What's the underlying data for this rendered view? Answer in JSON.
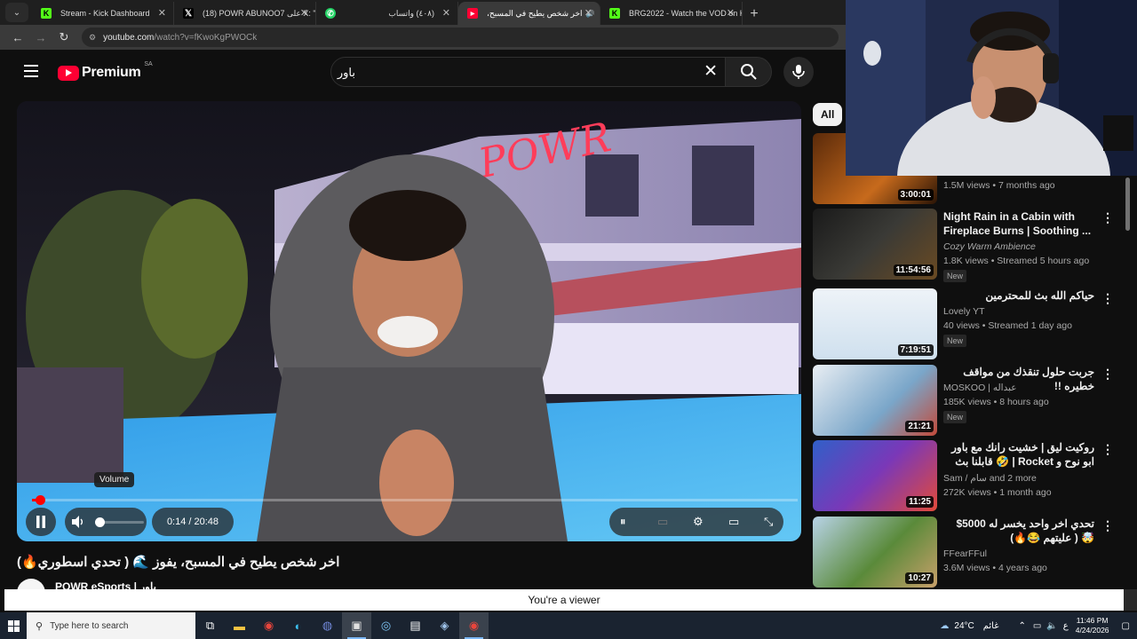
{
  "browser": {
    "tabs": [
      {
        "title": "Stream - Kick Dashboard",
        "favicon": "kick-icon",
        "color": "#53fc18",
        "active": false
      },
      {
        "title": "(18) POWR ABUNOO7 على X: \"",
        "favicon": "x-icon",
        "color": "#000000",
        "active": false
      },
      {
        "title": "(٤٠٨) واتساب",
        "favicon": "whatsapp-icon",
        "color": "#25d366",
        "active": false
      },
      {
        "title": "اخر شخص يطيح في المسبح،",
        "favicon": "youtube-icon",
        "color": "#ff0033",
        "active": true
      },
      {
        "title": "BRG2022 - Watch the VOD on K",
        "favicon": "kick-icon",
        "color": "#53fc18",
        "active": false
      }
    ],
    "new_tab": "+",
    "url_host": "youtube.com",
    "url_path": "/watch?v=fKwoKgPWOCk"
  },
  "youtube": {
    "brand": "Premium",
    "country": "SA",
    "search_query": "باور",
    "player": {
      "tooltip": "Volume",
      "time": "0:14 / 20:48",
      "progress": 0.011
    },
    "video_title": "اخر شخص يطيح في المسبح، يفوز 🌊 ( تحدي اسطوري🔥)",
    "channel": "POWR eSports | باور",
    "filter_chip": "All",
    "suggestions": [
      {
        "title": "",
        "channel": "",
        "meta": "1.5M views • 7 months ago",
        "duration": "3:00:01",
        "new": false,
        "rtl": false
      },
      {
        "title": "Night Rain in a Cabin with Fireplace Burns | Soothing ...",
        "channel": "Cozy Warm Ambience",
        "meta": "1.8K views • Streamed 5 hours ago",
        "duration": "11:54:56",
        "new": true,
        "rtl": false
      },
      {
        "title": "حياكم الله بث للمحترمين",
        "channel": "Lovely YT",
        "meta": "40 views • Streamed 1 day ago",
        "duration": "7:19:51",
        "new": true,
        "rtl": true
      },
      {
        "title": "جربت حلول تنقذك من مواقف خطيره !!",
        "channel": "MOSKOO | عبداله",
        "meta": "185K views • 8 hours ago",
        "duration": "21:21",
        "new": true,
        "rtl": true
      },
      {
        "title": "روكيت ليق | خشيت رانك مع باور ابو نوح و Rocket | 🤣 قابلنا بث سوبر سونيك ؟ ...",
        "channel": "Sam / سام and 2 more",
        "meta": "272K views • 1 month ago",
        "duration": "11:25",
        "new": false,
        "rtl": true
      },
      {
        "title": "تحدي اخر واحد يخسر له 5000$ 🤯 ( عليتهم 😂🔥)",
        "channel": "FFearFFul",
        "meta": "3.6M views • 4 years ago",
        "duration": "10:27",
        "new": false,
        "rtl": true
      }
    ],
    "new_label": "New"
  },
  "banner": {
    "text": "You're a viewer"
  },
  "taskbar": {
    "search_placeholder": "Type here to search",
    "weather": "24°C",
    "weather_desc": "غائم",
    "lang": "ع",
    "time": "11:46 PM",
    "date": "4/24/2026"
  },
  "colors": {
    "accent": "#ff0033",
    "kick": "#53fc18"
  }
}
